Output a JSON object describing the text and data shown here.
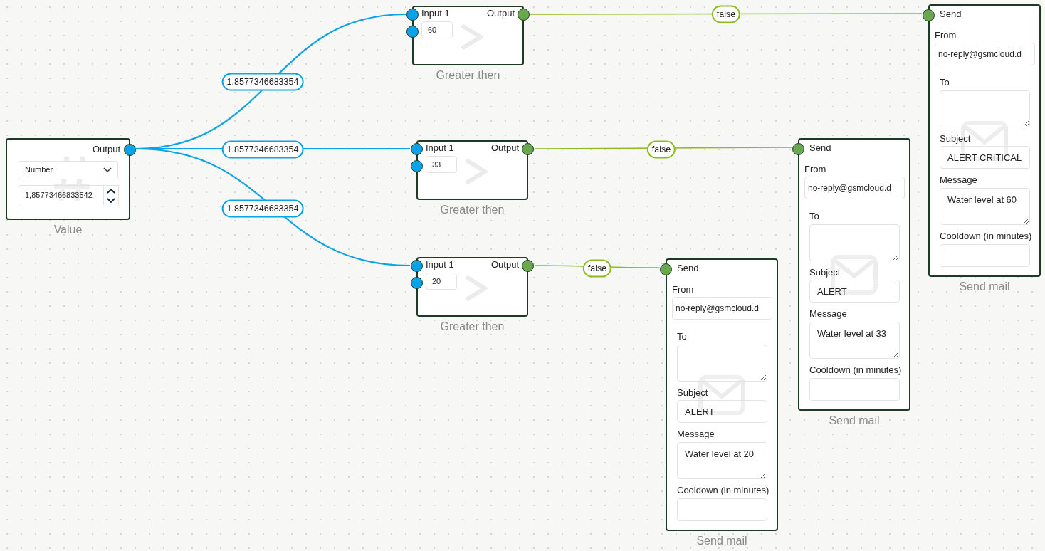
{
  "value_node": {
    "title": "Value",
    "output_label": "Output",
    "type_select": "Number",
    "number_value": "1,85773466833542"
  },
  "comparators": [
    {
      "title": "Greater then",
      "input_label": "Input 1",
      "output_label": "Output",
      "threshold": "60",
      "incoming_label": "1.8577346683354",
      "outgoing_label": "false"
    },
    {
      "title": "Greater then",
      "input_label": "Input 1",
      "output_label": "Output",
      "threshold": "33",
      "incoming_label": "1.8577346683354",
      "outgoing_label": "false"
    },
    {
      "title": "Greater then",
      "input_label": "Input 1",
      "output_label": "Output",
      "threshold": "20",
      "incoming_label": "1.8577346683354",
      "outgoing_label": "false"
    }
  ],
  "mailers": [
    {
      "title": "Send mail",
      "input_label": "Send",
      "fields": [
        {
          "label": "From",
          "kind": "input",
          "value": "no-reply@gsmcloud.d"
        },
        {
          "label": "To",
          "kind": "textarea"
        },
        {
          "label": "Subject",
          "kind": "input",
          "value": "ALERT CRITICAL"
        },
        {
          "label": "Message",
          "kind": "textarea",
          "value": "Water level at 60"
        },
        {
          "label": "Cooldown (in minutes)",
          "kind": "input"
        }
      ]
    },
    {
      "title": "Send mail",
      "input_label": "Send",
      "fields": [
        {
          "label": "From",
          "kind": "input",
          "value": "no-reply@gsmcloud.d"
        },
        {
          "label": "To",
          "kind": "textarea"
        },
        {
          "label": "Subject",
          "kind": "input",
          "value": "ALERT"
        },
        {
          "label": "Message",
          "kind": "textarea",
          "value": "Water level at 33"
        },
        {
          "label": "Cooldown (in minutes)",
          "kind": "input"
        }
      ]
    },
    {
      "title": "Send mail",
      "input_label": "Send",
      "fields": [
        {
          "label": "From",
          "kind": "input",
          "value": "no-reply@gsmcloud.d"
        },
        {
          "label": "To",
          "kind": "textarea"
        },
        {
          "label": "Subject",
          "kind": "input",
          "value": "ALERT"
        },
        {
          "label": "Message",
          "kind": "textarea",
          "value": "Water level at 20"
        },
        {
          "label": "Cooldown (in minutes)",
          "kind": "input"
        }
      ]
    }
  ]
}
